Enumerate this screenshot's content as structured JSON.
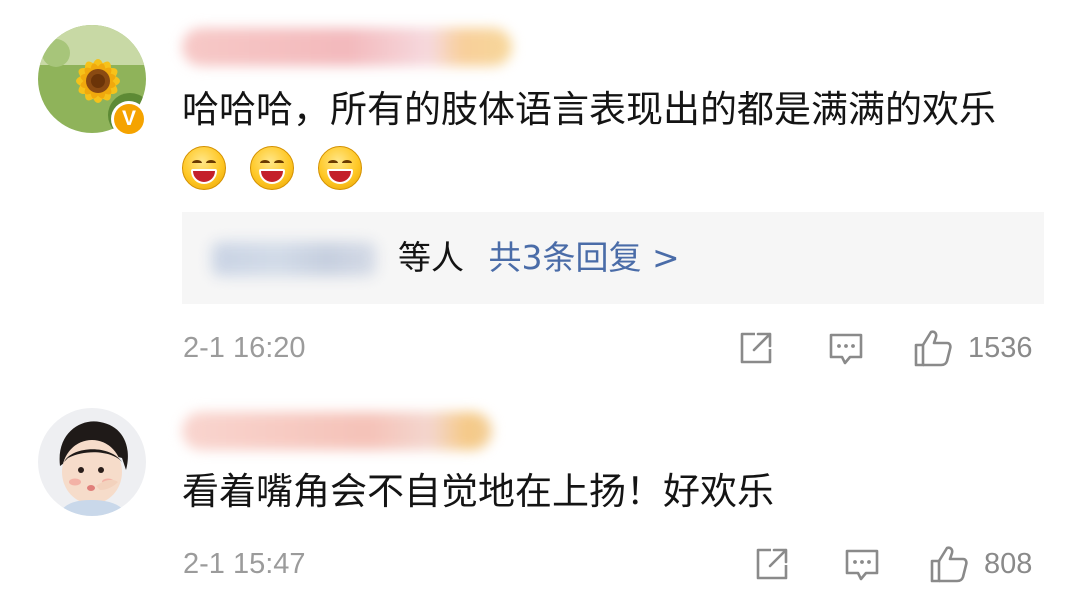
{
  "comments": [
    {
      "text": "哈哈哈，所有的肢体语言表现出的都是满满的欢乐",
      "emojis": [
        "grinning-face-emoji",
        "grinning-face-emoji",
        "grinning-face-emoji"
      ],
      "verified_badge": "V",
      "replies": {
        "suffix": "等人",
        "link": "共3条回复 >"
      },
      "time": "2-1 16:20",
      "likes": "1536"
    },
    {
      "text": "看着嘴角会不自觉地在上扬！好欢乐",
      "time": "2-1 15:47",
      "likes": "808"
    }
  ],
  "colors": {
    "text": "#141414",
    "meta": "#9b9b9b",
    "link": "#4a6ca8",
    "verified": "#f5a300",
    "reply_box": "#f6f6f6"
  }
}
